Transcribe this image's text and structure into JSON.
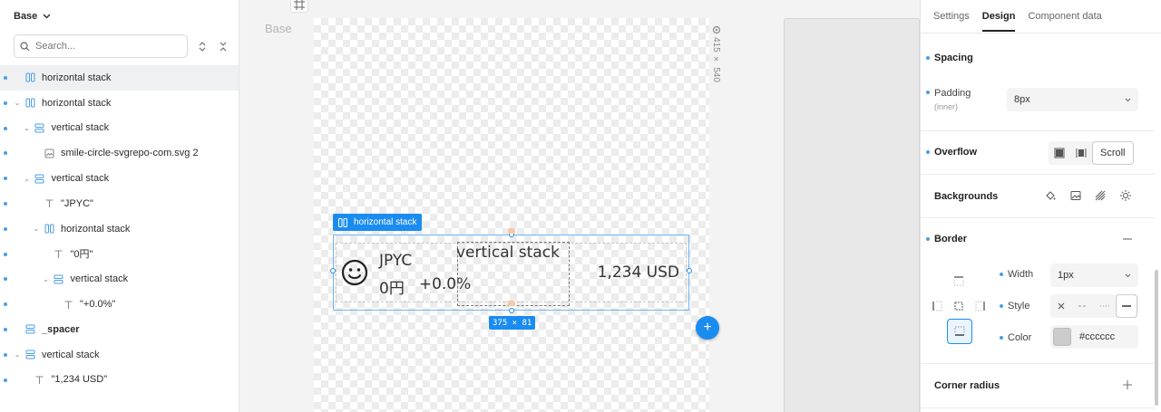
{
  "left": {
    "page": "Base",
    "search_placeholder": "Search...",
    "layers": [
      {
        "label": "horizontal stack",
        "icon": "hstack-icon",
        "indent": 0,
        "chevron": false,
        "selected": true
      },
      {
        "label": "horizontal stack",
        "icon": "hstack-icon",
        "indent": 0,
        "chevron": true
      },
      {
        "label": "vertical stack",
        "icon": "vstack-icon",
        "indent": 1,
        "chevron": true
      },
      {
        "label": "smile-circle-svgrepo-com.svg 2",
        "icon": "image-icon",
        "indent": 2,
        "chevron": false
      },
      {
        "label": "vertical stack",
        "icon": "vstack-icon",
        "indent": 1,
        "chevron": true
      },
      {
        "label": "\"JPYC\"",
        "icon": "text-icon",
        "indent": 2,
        "chevron": false
      },
      {
        "label": "horizontal stack",
        "icon": "hstack-icon",
        "indent": 2,
        "chevron": true
      },
      {
        "label": "\"0円\"",
        "icon": "text-icon",
        "indent": 3,
        "chevron": false
      },
      {
        "label": "vertical stack",
        "icon": "vstack-icon",
        "indent": 3,
        "chevron": true
      },
      {
        "label": "\"+0.0%\"",
        "icon": "text-icon",
        "indent": 4,
        "chevron": false
      },
      {
        "label": "_spacer",
        "icon": "vstack-icon",
        "indent": 0,
        "chevron": false,
        "bold": true
      },
      {
        "label": "vertical stack",
        "icon": "vstack-icon",
        "indent": 0,
        "chevron": true
      },
      {
        "label": "\"1,234 USD\"",
        "icon": "text-icon",
        "indent": 1,
        "chevron": false
      }
    ]
  },
  "canvas": {
    "base_label": "Base",
    "artboard_size": "415 × 540",
    "selection_tag": "horizontal stack",
    "size_tag": "375 × 81",
    "content": {
      "title": "JPYC",
      "amount": "0円",
      "change": "+0.0%",
      "inner_label": "vertical stack",
      "usd": "1,234 USD"
    }
  },
  "right": {
    "tabs": [
      "Settings",
      "Design",
      "Component data"
    ],
    "active_tab": "Design",
    "spacing": {
      "title": "Spacing",
      "padding_label": "Padding",
      "padding_sub": "(inner)",
      "padding_value": "8px"
    },
    "overflow": {
      "title": "Overflow",
      "active": "Scroll"
    },
    "backgrounds": {
      "title": "Backgrounds"
    },
    "border": {
      "title": "Border",
      "width_label": "Width",
      "width_value": "1px",
      "style_label": "Style",
      "color_label": "Color",
      "color_value": "#cccccc"
    },
    "corner_radius": {
      "title": "Corner radius"
    }
  },
  "colors": {
    "accent": "#1a8cf0",
    "border_color": "#cccccc"
  }
}
